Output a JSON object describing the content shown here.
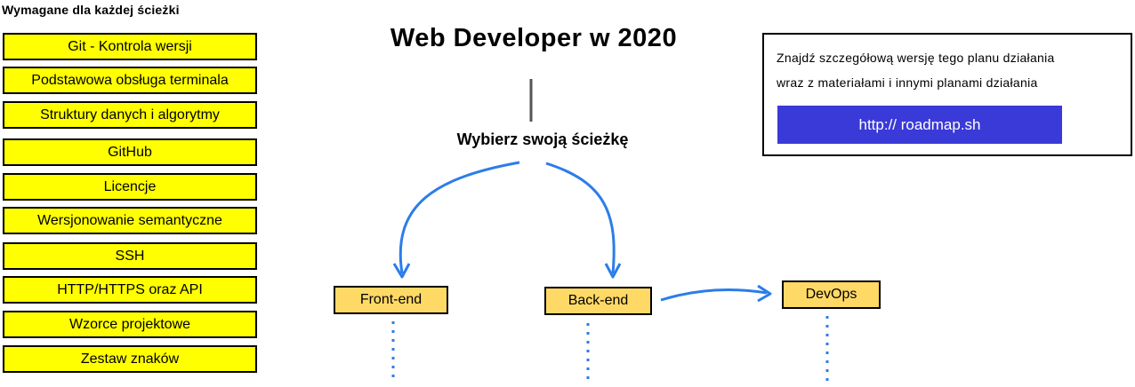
{
  "required_section": {
    "heading": "Wymagane dla każdej ścieżki",
    "items": [
      "Git - Kontrola wersji",
      "Podstawowa obsługa terminala",
      "Struktury danych i algorytmy",
      "GitHub",
      "Licencje",
      "Wersjonowanie semantyczne",
      "SSH",
      "HTTP/HTTPS oraz API",
      "Wzorce projektowe",
      "Zestaw znaków"
    ]
  },
  "roadmap": {
    "title": "Web Developer w 2020",
    "subtitle": "Wybierz swoją ścieżkę",
    "paths": {
      "frontend": "Front-end",
      "backend": "Back-end",
      "devops": "DevOps"
    }
  },
  "info_box": {
    "line1": "Znajdź szczegółową wersję tego planu działania",
    "line2": "wraz z materiałami i innymi planami działania",
    "link_text": "http:// roadmap.sh"
  },
  "colors": {
    "required_item_fill": "#ffff00",
    "path_node_fill": "#ffd966",
    "arrow": "#2b7de9",
    "link_button": "#3a3ad8"
  }
}
